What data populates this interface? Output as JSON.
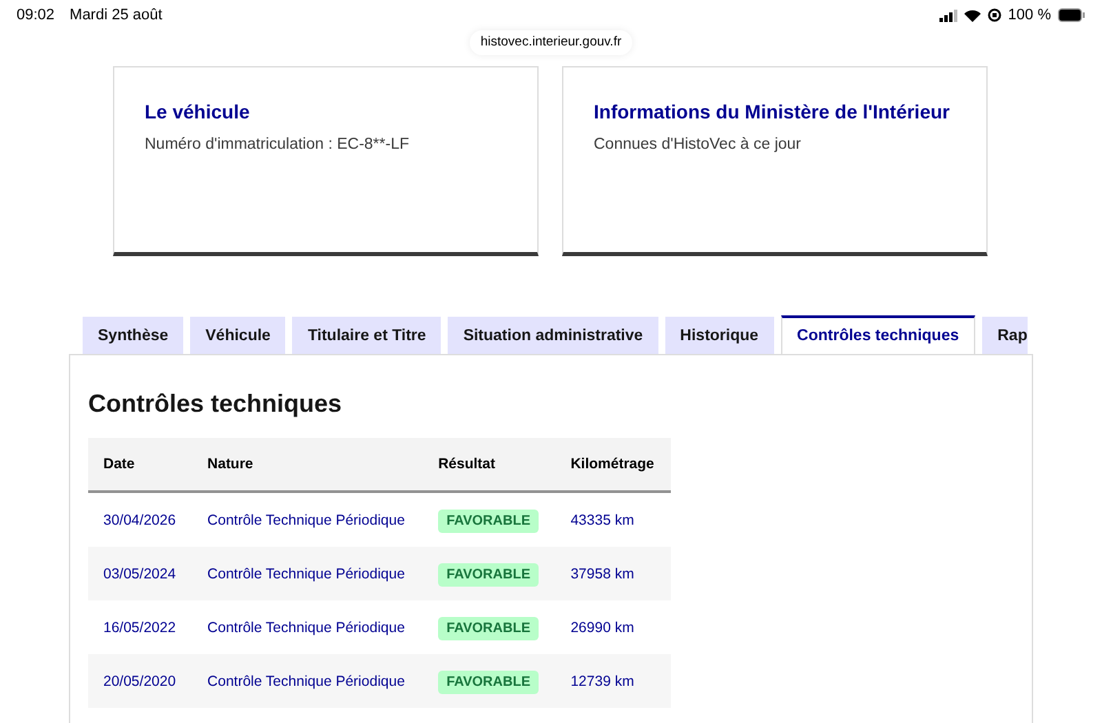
{
  "status_bar": {
    "time": "09:02",
    "date": "Mardi 25 août",
    "battery": "100 %"
  },
  "url": "histovec.interieur.gouv.fr",
  "cards": [
    {
      "title": "Le véhicule",
      "text": "Numéro d'immatriculation : EC-8**-LF"
    },
    {
      "title": "Informations du Ministère de l'Intérieur",
      "text": "Connues d'HistoVec à ce jour"
    }
  ],
  "tabs": [
    {
      "label": "Synthèse",
      "selected": false
    },
    {
      "label": "Véhicule",
      "selected": false
    },
    {
      "label": "Titulaire et Titre",
      "selected": false
    },
    {
      "label": "Situation administrative",
      "selected": false
    },
    {
      "label": "Historique",
      "selected": false
    },
    {
      "label": "Contrôles techniques",
      "selected": true
    },
    {
      "label": "Rap",
      "selected": false
    }
  ],
  "section_title": "Contrôles techniques",
  "table": {
    "columns": [
      "Date",
      "Nature",
      "Résultat",
      "Kilométrage"
    ],
    "rows": [
      {
        "date": "30/04/2026",
        "nature": "Contrôle Technique Périodique",
        "result": "FAVORABLE",
        "km": "43335 km"
      },
      {
        "date": "03/05/2024",
        "nature": "Contrôle Technique Périodique",
        "result": "FAVORABLE",
        "km": "37958 km"
      },
      {
        "date": "16/05/2022",
        "nature": "Contrôle Technique Périodique",
        "result": "FAVORABLE",
        "km": "26990 km"
      },
      {
        "date": "20/05/2020",
        "nature": "Contrôle Technique Périodique",
        "result": "FAVORABLE",
        "km": "12739 km"
      }
    ]
  }
}
